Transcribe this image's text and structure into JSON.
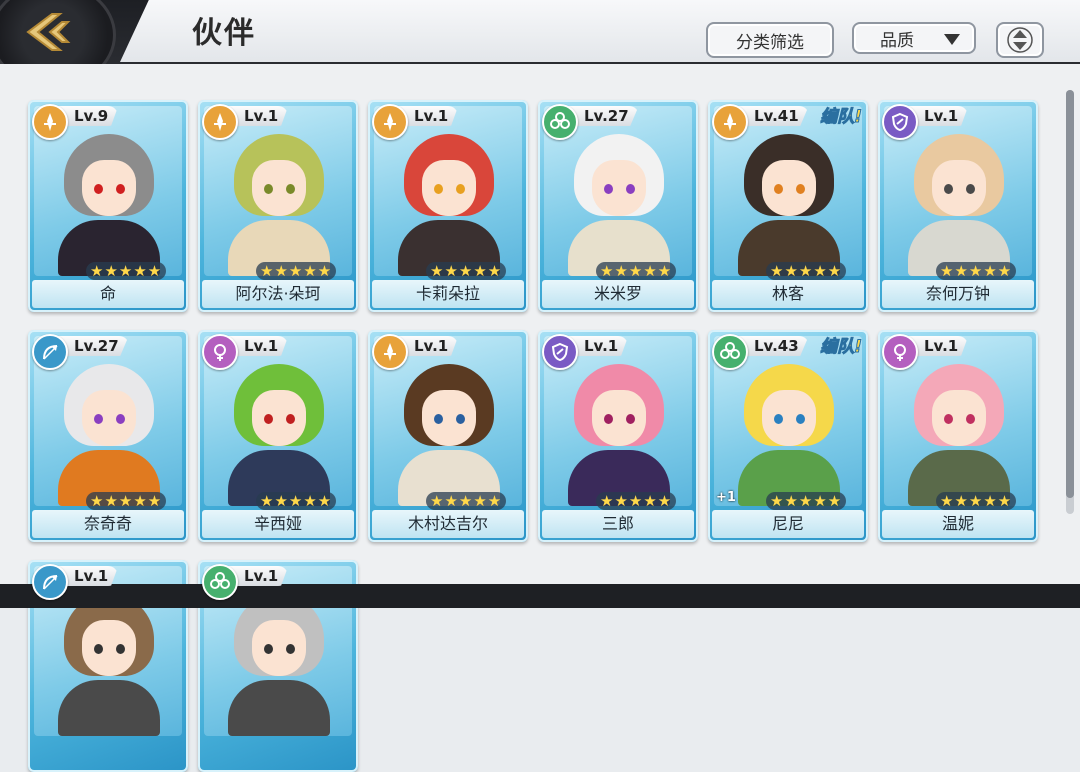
{
  "header": {
    "title": "伙伴",
    "filter_label": "分类筛选",
    "quality_label": "品质",
    "back_icon": "back-arrow-icon",
    "sort_icon": "sort-updown-icon"
  },
  "colors": {
    "card_blue": "#4bb4dc",
    "star_gold": "#ffd84a",
    "class_attack": "#e8a23a",
    "class_heal": "#46b06e",
    "class_tank": "#7a5bc4",
    "class_ranged": "#3a98c9",
    "class_support": "#b45fbf"
  },
  "cards": [
    {
      "level": "Lv.9",
      "name": "命",
      "stars": "★★★★★",
      "class": "attack",
      "team": "",
      "plus": "",
      "hair": "#8c8c8c",
      "body": "#2a2430",
      "eye": "#d02020"
    },
    {
      "level": "Lv.1",
      "name": "阿尔法·朵珂",
      "stars": "★★★★★",
      "class": "attack",
      "team": "",
      "plus": "",
      "hair": "#b7c25a",
      "body": "#e8d8b8",
      "eye": "#7a8a2a"
    },
    {
      "level": "Lv.1",
      "name": "卡莉朵拉",
      "stars": "★★★★★",
      "class": "attack",
      "team": "",
      "plus": "",
      "hair": "#d9463a",
      "body": "#3a3030",
      "eye": "#e8a020"
    },
    {
      "level": "Lv.27",
      "name": "米米罗",
      "stars": "★★★★★",
      "class": "heal",
      "team": "",
      "plus": "",
      "hair": "#f2f2f2",
      "body": "#e7e0cc",
      "eye": "#8a3fc0"
    },
    {
      "level": "Lv.41",
      "name": "林客",
      "stars": "★★★★★",
      "class": "attack",
      "team": "编队!",
      "plus": "",
      "hair": "#3a2e28",
      "body": "#4a3a2c",
      "eye": "#e08020"
    },
    {
      "level": "Lv.1",
      "name": "奈何万钟",
      "stars": "★★★★★",
      "class": "tank",
      "team": "",
      "plus": "",
      "hair": "#e9c9a0",
      "body": "#d8d8d0",
      "eye": "#4a4a4a"
    },
    {
      "level": "Lv.27",
      "name": "奈奇奇",
      "stars": "★★★★★",
      "class": "ranged",
      "team": "",
      "plus": "",
      "hair": "#e8e8ea",
      "body": "#e07a20",
      "eye": "#8a3fc0"
    },
    {
      "level": "Lv.1",
      "name": "辛西娅",
      "stars": "★★★★★",
      "class": "support",
      "team": "",
      "plus": "",
      "hair": "#6fbf3a",
      "body": "#2e3a5a",
      "eye": "#c02020"
    },
    {
      "level": "Lv.1",
      "name": "木村达吉尔",
      "stars": "★★★★★",
      "class": "attack",
      "team": "",
      "plus": "",
      "hair": "#5a3a22",
      "body": "#e8e0d0",
      "eye": "#2a60a0"
    },
    {
      "level": "Lv.1",
      "name": "三郎",
      "stars": "★★★★★",
      "class": "tank",
      "team": "",
      "plus": "",
      "hair": "#f08aa8",
      "body": "#3a2a5a",
      "eye": "#a02060"
    },
    {
      "level": "Lv.43",
      "name": "尼尼",
      "stars": "★★★★★",
      "class": "heal",
      "team": "编队!",
      "plus": "+1",
      "hair": "#f5d84a",
      "body": "#5aa04a",
      "eye": "#2a80c0"
    },
    {
      "level": "Lv.1",
      "name": "温妮",
      "stars": "★★★★★",
      "class": "support",
      "team": "",
      "plus": "",
      "hair": "#f4a8b8",
      "body": "#5a6a4a",
      "eye": "#c03060"
    },
    {
      "level": "Lv.1",
      "name": "",
      "stars": "",
      "class": "ranged",
      "team": "",
      "plus": "",
      "hair": "#8a6a4a",
      "body": "#4a4a4a",
      "eye": "#333333"
    },
    {
      "level": "Lv.1",
      "name": "",
      "stars": "",
      "class": "heal",
      "team": "",
      "plus": "",
      "hair": "#c0c0c0",
      "body": "#4a4a4a",
      "eye": "#333333"
    }
  ]
}
